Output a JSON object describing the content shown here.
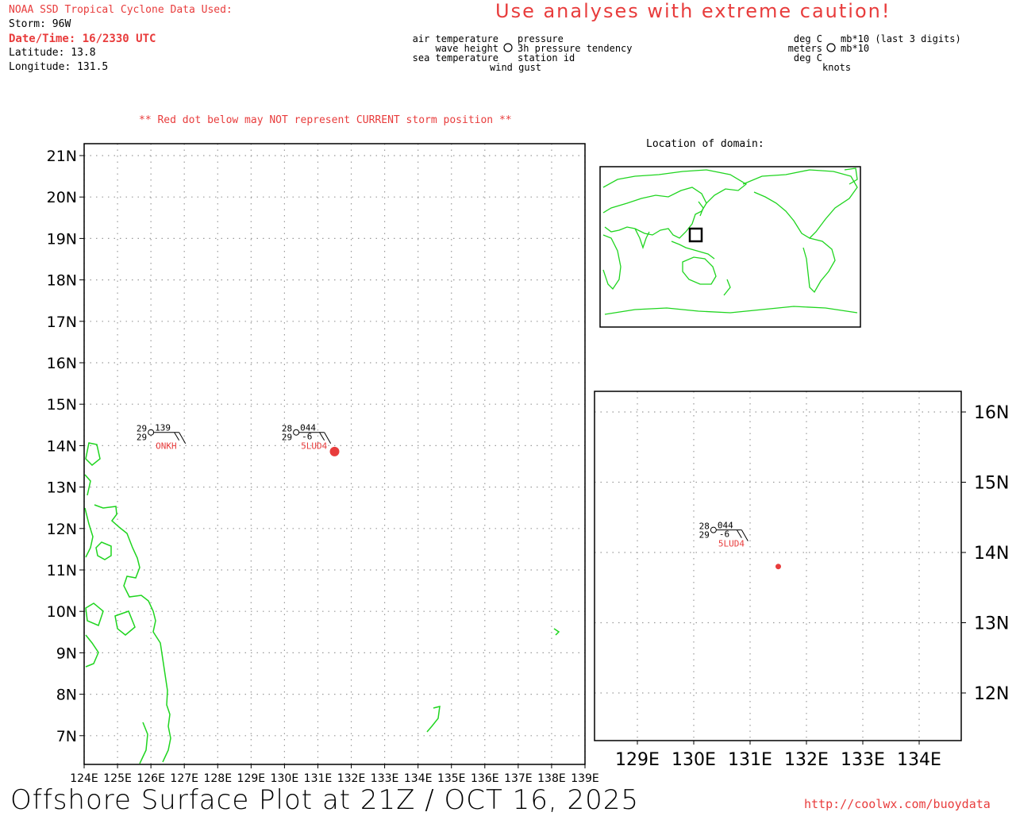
{
  "header": {
    "source_title": "NOAA SSD Tropical Cyclone Data Used:",
    "storm": "Storm: 96W",
    "datetime": "Date/Time: 16/2330 UTC",
    "latitude": "Latitude: 13.8",
    "longitude": "Longitude: 131.5",
    "caution": "Use analyses with extreme caution!"
  },
  "legend": {
    "left": {
      "air_temperature": "air temperature",
      "wave_height": "wave height",
      "sea_temperature": "sea temperature",
      "pressure": "pressure",
      "pressure_tendency": "3h pressure tendency",
      "station_id": "station id",
      "wind_gust": "wind gust"
    },
    "right": {
      "deg_c_1": "deg C",
      "meters": "meters",
      "deg_c_2": "deg C",
      "mb_last3": "mb*10 (last 3 digits)",
      "mb10": "mb*10",
      "knots": "knots"
    }
  },
  "notice": "** Red dot below may NOT represent CURRENT storm position **",
  "inset_title": "Location of domain:",
  "main_map": {
    "lat_labels": [
      "21N",
      "20N",
      "19N",
      "18N",
      "17N",
      "16N",
      "15N",
      "14N",
      "13N",
      "12N",
      "11N",
      "10N",
      "9N",
      "8N",
      "7N"
    ],
    "lon_labels": [
      "124E",
      "125E",
      "126E",
      "127E",
      "128E",
      "129E",
      "130E",
      "131E",
      "132E",
      "133E",
      "134E",
      "135E",
      "136E",
      "137E",
      "138E",
      "139E"
    ],
    "stations": [
      {
        "id": "ONKH",
        "air_temp": "29",
        "sea_temp": "29",
        "pressure": "139",
        "tendency": ""
      },
      {
        "id": "5LUD4",
        "air_temp": "28",
        "sea_temp": "29",
        "pressure": "044",
        "tendency": "-6"
      }
    ],
    "storm_position": {
      "lat": 13.8,
      "lon": 131.5
    }
  },
  "zoom_map": {
    "lat_labels": [
      "16N",
      "15N",
      "14N",
      "13N",
      "12N"
    ],
    "lon_labels": [
      "129E",
      "130E",
      "131E",
      "132E",
      "133E",
      "134E"
    ],
    "station": {
      "id": "5LUD4",
      "air_temp": "28",
      "sea_temp": "29",
      "pressure": "044",
      "tendency": "-6"
    }
  },
  "footer": {
    "title": "Offshore Surface Plot at 21Z / OCT 16, 2025",
    "url": "http://coolwx.com/buoydata"
  },
  "colors": {
    "accent": "#e83c3c",
    "coast": "#1fd51f",
    "grid": "#9a9a9a",
    "frame": "#000000"
  }
}
